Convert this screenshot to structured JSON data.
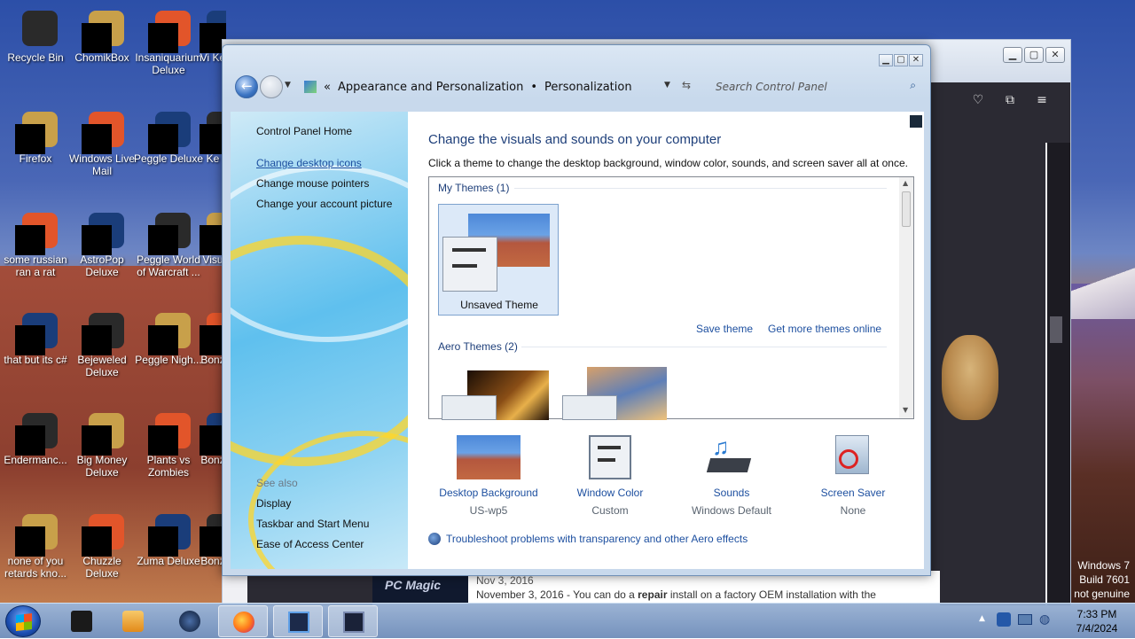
{
  "desktop_icons": [
    {
      "label": "Recycle Bin",
      "name": "recycle-bin"
    },
    {
      "label": "ChomikBox",
      "name": "chomikbox"
    },
    {
      "label": "Insaniquarium Deluxe",
      "name": "insaniquarium"
    },
    {
      "label": "Vi Ke",
      "name": "vi-ke"
    },
    {
      "label": "Firefox",
      "name": "firefox"
    },
    {
      "label": "Windows Live Mail",
      "name": "windows-live-mail"
    },
    {
      "label": "Peggle Deluxe",
      "name": "peggle-deluxe"
    },
    {
      "label": "Ke",
      "name": "ke"
    },
    {
      "label": "some russian ran a rat",
      "name": "some-russian"
    },
    {
      "label": "AstroPop Deluxe",
      "name": "astropop"
    },
    {
      "label": "Peggle World of Warcraft ...",
      "name": "peggle-wow"
    },
    {
      "label": "Visu",
      "name": "visu"
    },
    {
      "label": "that but its c#",
      "name": "that-but"
    },
    {
      "label": "Bejeweled Deluxe",
      "name": "bejeweled"
    },
    {
      "label": "Peggle Nigh...",
      "name": "peggle-nights"
    },
    {
      "label": "Bonz",
      "name": "bonz-1"
    },
    {
      "label": "Endermanc...",
      "name": "endermanc"
    },
    {
      "label": "Big Money Deluxe",
      "name": "big-money"
    },
    {
      "label": "Plants vs Zombies",
      "name": "plants-vs-zombies"
    },
    {
      "label": "Bonz",
      "name": "bonz-2"
    },
    {
      "label": "none of you retards kno...",
      "name": "none-of-you"
    },
    {
      "label": "Chuzzle Deluxe",
      "name": "chuzzle"
    },
    {
      "label": "Zuma Deluxe",
      "name": "zuma"
    },
    {
      "label": "Bonz",
      "name": "bonz-3"
    }
  ],
  "control_panel": {
    "breadcrumb": {
      "chevrons": "«",
      "part1": "Appearance and Personalization",
      "separator": "•",
      "part2": "Personalization"
    },
    "search_placeholder": "Search Control Panel",
    "left_links": {
      "home": "Control Panel Home",
      "desktop_icons": "Change desktop icons",
      "mouse_pointers": "Change mouse pointers",
      "account_picture": "Change your account picture"
    },
    "see_also": {
      "heading": "See also",
      "display": "Display",
      "taskbar": "Taskbar and Start Menu",
      "ease": "Ease of Access Center"
    },
    "title": "Change the visuals and sounds on your computer",
    "subtitle": "Click a theme to change the desktop background, window color, sounds, and screen saver all at once.",
    "my_themes": "My Themes (1)",
    "unsaved_theme": "Unsaved Theme",
    "save_theme": "Save theme",
    "get_more": "Get more themes online",
    "aero_themes": "Aero Themes (2)",
    "settings": [
      {
        "label": "Desktop Background",
        "value": "US-wp5"
      },
      {
        "label": "Window Color",
        "value": "Custom"
      },
      {
        "label": "Sounds",
        "value": "Windows Default"
      },
      {
        "label": "Screen Saver",
        "value": "None"
      }
    ],
    "troubleshoot": "Troubleshoot problems with transparency and other Aero effects"
  },
  "browser_snippet": {
    "logo": "PC Magic",
    "date": "Nov 3, 2016",
    "text_prefix": "November 3, 2016 - You can do a",
    "text_bold": "repair",
    "text_suffix": "install on a factory OEM installation with the"
  },
  "watermark": {
    "line1": "Windows 7",
    "line2": "Build 7601",
    "line3": "not genuine"
  },
  "clock": {
    "time": "7:33 PM",
    "date": "7/4/2024"
  },
  "colors": {
    "link": "#1e50a0",
    "title": "#1e3f7a",
    "taskbar": "#8aa6cc"
  }
}
